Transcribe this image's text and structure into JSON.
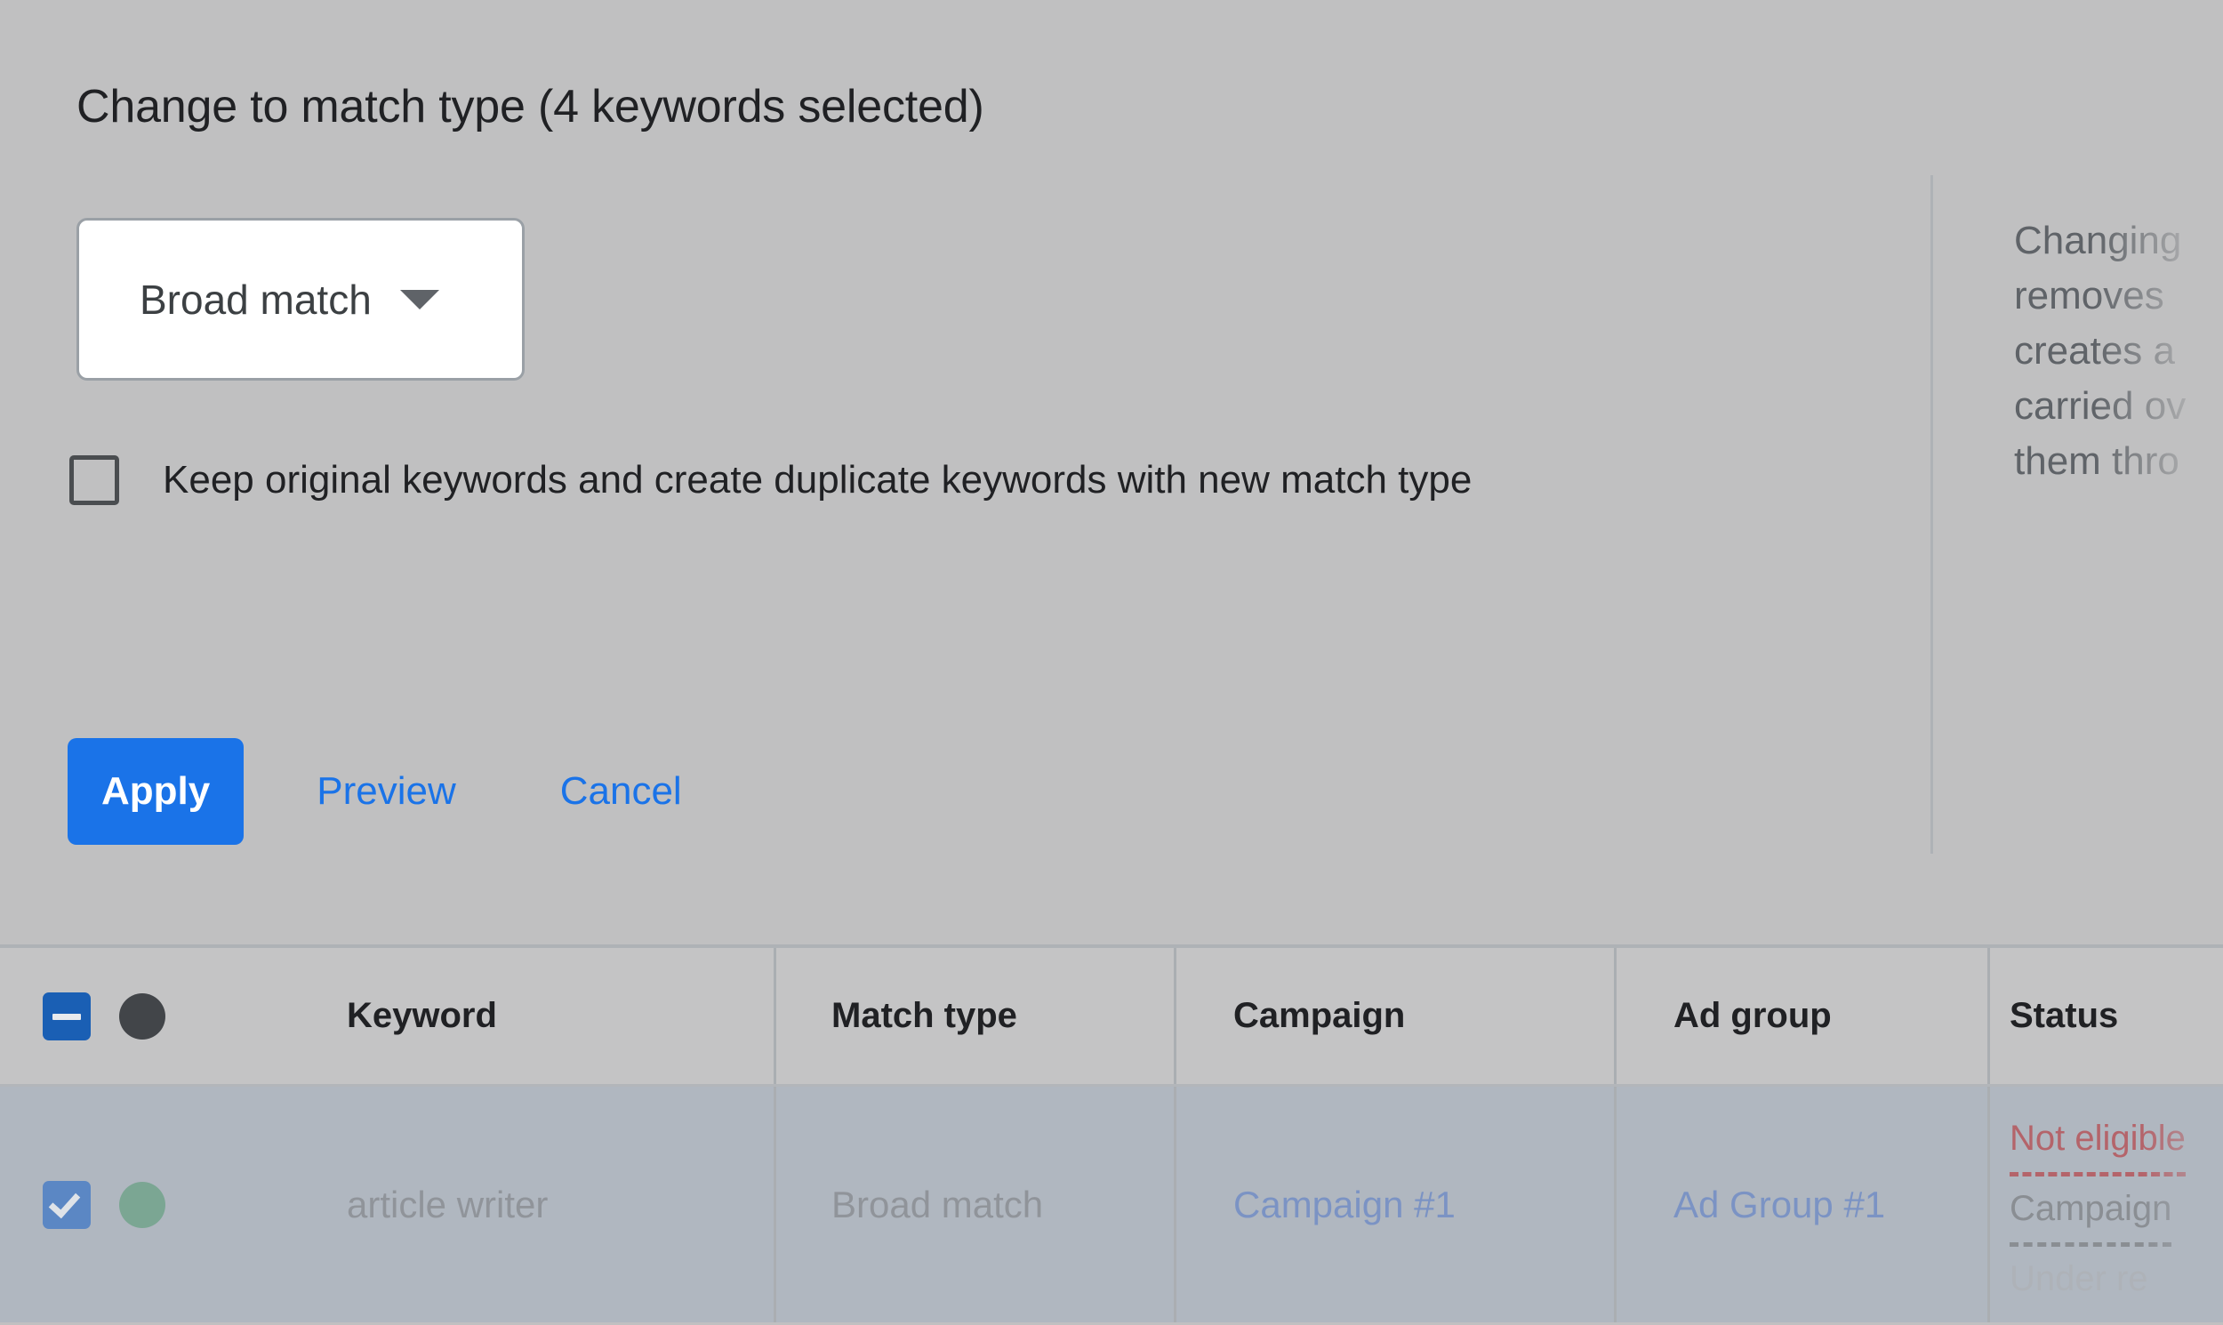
{
  "dialog": {
    "title": "Change to match type (4 keywords selected)",
    "match_type_select": {
      "value": "Broad match",
      "caret_icon": "chevron-down-icon"
    },
    "keep_original": {
      "label": "Keep original keywords and create duplicate keywords with new match type",
      "checked": false
    },
    "buttons": {
      "apply": "Apply",
      "preview": "Preview",
      "cancel": "Cancel"
    },
    "help_panel": {
      "lines": [
        "Changing",
        "removes",
        "creates a",
        "carried ov",
        "them thro"
      ]
    }
  },
  "table": {
    "headers": {
      "keyword": "Keyword",
      "match_type": "Match type",
      "campaign": "Campaign",
      "ad_group": "Ad group",
      "status": "Status"
    },
    "header_checkbox_state": "indeterminate",
    "rows": [
      {
        "selected": true,
        "keyword": "article writer",
        "match_type": "Broad match",
        "campaign": "Campaign #1",
        "ad_group": "Ad Group #1",
        "status_lines": [
          "Not eligible",
          "Campaign",
          "Under re"
        ]
      }
    ]
  },
  "colors": {
    "accent_blue": "#1a73e8",
    "checkbox_blue": "#1a5fb4",
    "status_green": "#7ba693",
    "status_dark": "#424549",
    "error_red": "#b4646a",
    "background": "#c0c0c1",
    "selected_row": "#b0b7c0"
  }
}
